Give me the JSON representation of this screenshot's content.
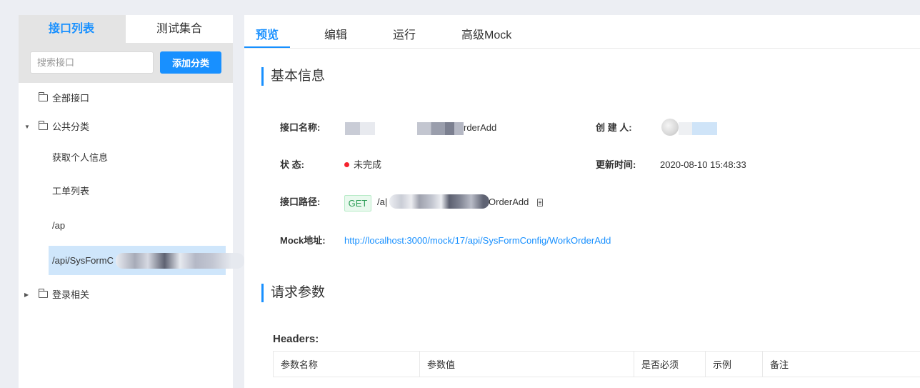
{
  "sidebar": {
    "tabs": {
      "active": "接口列表",
      "inactive": "测试集合"
    },
    "search_placeholder": "搜索接口",
    "add_category_label": "添加分类",
    "tree": {
      "all": "全部接口",
      "public_category": "公共分类",
      "items": [
        "获取个人信息",
        "工单列表",
        "/ap",
        "/api/SysFormC"
      ],
      "login_category": "登录相关"
    }
  },
  "tabs": [
    "预览",
    "编辑",
    "运行",
    "高级Mock"
  ],
  "basic_info": {
    "title": "基本信息",
    "name_label": "接口名称:",
    "name_value": "rderAdd",
    "creator_label": "创  建  人:",
    "status_label": "状      态:",
    "status_value": "未完成",
    "updated_label": "更新时间:",
    "updated_value": "2020-08-10 15:48:33",
    "path_label": "接口路径:",
    "method": "GET",
    "path_prefix": "/a|",
    "path_suffix": "OrderAdd",
    "mock_label": "Mock地址:",
    "mock_url": "http://localhost:3000/mock/17/api/SysFormConfig/WorkOrderAdd"
  },
  "request": {
    "title": "请求参数",
    "headers_label": "Headers:",
    "columns": [
      "参数名称",
      "参数值",
      "是否必须",
      "示例",
      "备注"
    ]
  },
  "colors": {
    "accent": "#1890ff",
    "status": "#f5222d",
    "get_tag": "#2f9e58"
  }
}
